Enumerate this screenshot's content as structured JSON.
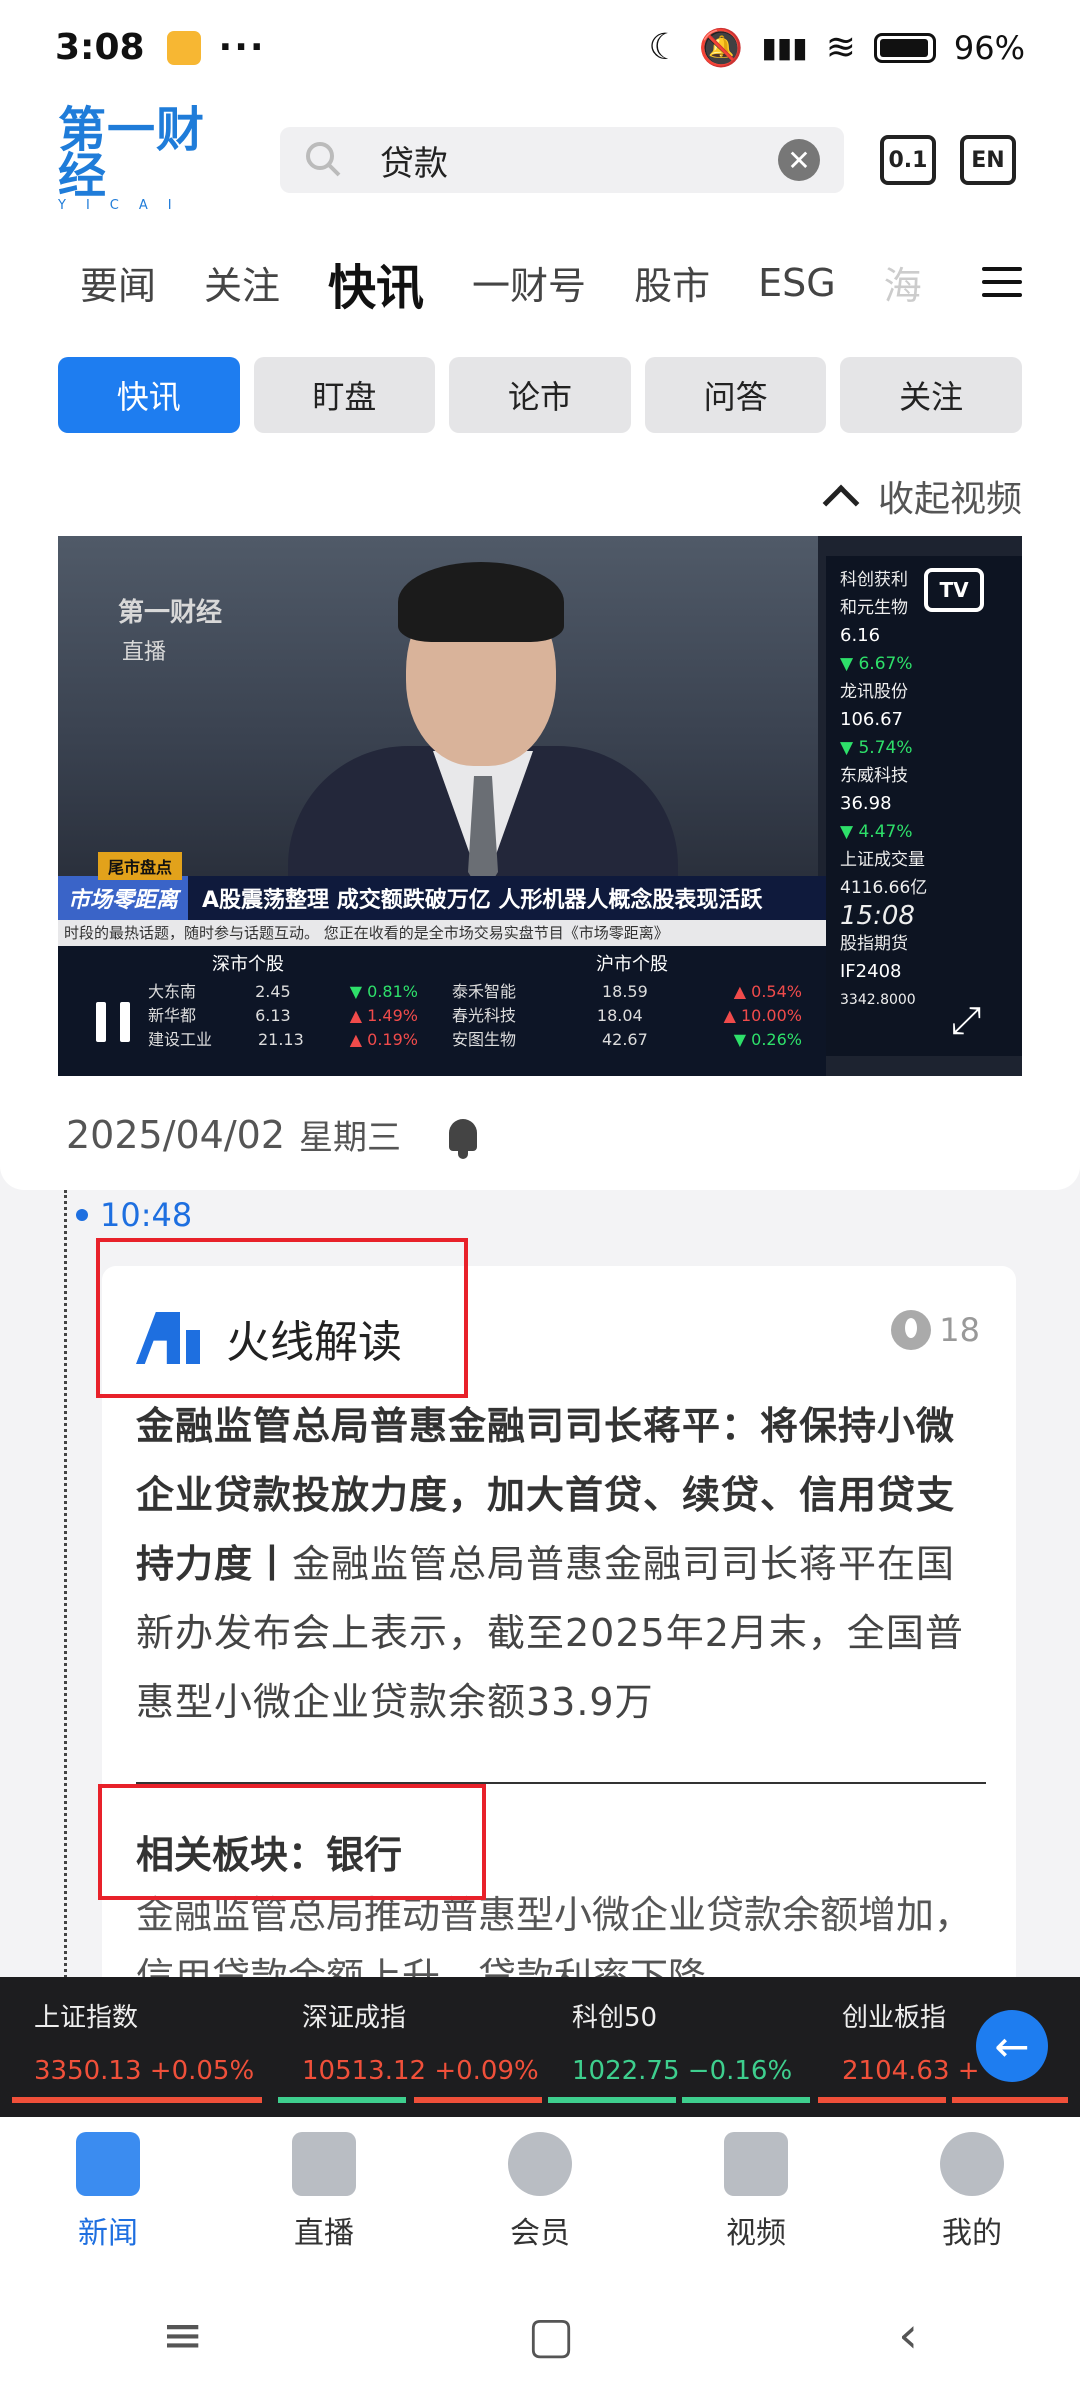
{
  "status": {
    "time": "3:08",
    "dots": "···",
    "battery": "96%"
  },
  "header": {
    "logo_cn": "第一财经",
    "logo_en": "YICAI",
    "search_query": "贷款",
    "radio_label": "0.1",
    "lang_label": "EN"
  },
  "categories": [
    "要闻",
    "关注",
    "快讯",
    "一财号",
    "股市",
    "ESG",
    "海"
  ],
  "subtabs": [
    "快讯",
    "盯盘",
    "论市",
    "问答",
    "关注"
  ],
  "collapse_label": "收起视频",
  "video": {
    "logo": "第一财经",
    "live": "直播",
    "tv": "TV",
    "side": {
      "s1_name": "科创获利",
      "s1b": "和元生物",
      "s1_price": "6.16",
      "s1_chg": "▼ 6.67%",
      "s2_name": "龙讯股份",
      "s2_price": "106.67",
      "s2_chg": "▼ 5.74%",
      "s3_name": "东威科技",
      "s3_price": "36.98",
      "s3_chg": "▼ 4.47%",
      "vol_label": "上证成交量",
      "vol_val": "4116.66亿",
      "clock": "15:08",
      "fut_label": "股指期货",
      "fut_code": "IF2408",
      "fut_val": "3342.8000"
    },
    "tag": "尾市盘点",
    "brand": "市场零距离",
    "headline": "A股震荡整理 成交额跌破万亿 人形机器人概念股表现活跃",
    "scroll": "时段的最热话题，随时参与话题互动。  您正在收看的是全市场交易实盘节目《市场零距离》",
    "sz_head": "深市个股",
    "sh_head": "沪市个股",
    "sz_rows": [
      {
        "n": "大东南",
        "p": "2.45",
        "c": "▼ 0.81%",
        "dir": "gu"
      },
      {
        "n": "新华都",
        "p": "6.13",
        "c": "▲ 1.49%",
        "dir": "dn"
      },
      {
        "n": "建设工业",
        "p": "21.13",
        "c": "▲ 0.19%",
        "dir": "dn"
      }
    ],
    "sh_rows": [
      {
        "n": "泰禾智能",
        "p": "18.59",
        "c": "▲ 0.54%",
        "dir": "dn"
      },
      {
        "n": "春光科技",
        "p": "18.04",
        "c": "▲ 10.00%",
        "dir": "dn"
      },
      {
        "n": "安图生物",
        "p": "42.67",
        "c": "▼ 0.26%",
        "dir": "gu"
      }
    ]
  },
  "date": "2025/04/02",
  "weekday": "星期三",
  "news": {
    "time": "10:48",
    "source": "火线解读",
    "heat": "18",
    "headline_bold": "金融监管总局普惠金融司司长蒋平：将保持小微企业贷款投放力度，加大首贷、续贷、信用贷支持力度丨",
    "body": "金融监管总局普惠金融司司长蒋平在国新办发布会上表示，截至2025年2月末，全国普惠型小微企业贷款余额33.9万",
    "related": "相关板块：银行",
    "sub": "金融监管总局推动普惠型小微企业贷款余额增加，信用贷款余额上升，贷款利率下降。"
  },
  "market": [
    {
      "name": "上证指数",
      "value": "3350.13",
      "change": "+0.05%",
      "color": "#f0503a"
    },
    {
      "name": "深证成指",
      "value": "10513.12",
      "change": "+0.09%",
      "color": "#f0503a"
    },
    {
      "name": "科创50",
      "value": "1022.75",
      "change": "−0.16%",
      "color": "#3ecf8e"
    },
    {
      "name": "创业板指",
      "value": "2104.63",
      "change": "+",
      "color": "#f0503a"
    }
  ],
  "bottom_nav": [
    "新闻",
    "直播",
    "会员",
    "视频",
    "我的"
  ],
  "sysnav": {
    "menu": "≡",
    "home": "▢",
    "back": "‹"
  }
}
